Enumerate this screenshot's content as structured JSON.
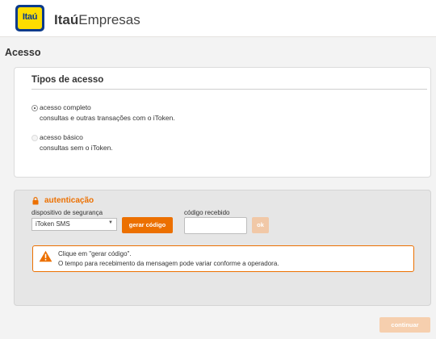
{
  "header": {
    "logo_text": "Itaú",
    "brand_bold": "Itaú",
    "brand_rest": "Empresas"
  },
  "page": {
    "title": "Acesso"
  },
  "access_types": {
    "title": "Tipos de acesso",
    "options": [
      {
        "label": "acesso completo",
        "description": "consultas e outras transações com o iToken.",
        "selected": true,
        "enabled": true
      },
      {
        "label": "acesso básico",
        "description": "consultas sem o iToken.",
        "selected": false,
        "enabled": false
      }
    ]
  },
  "authentication": {
    "title": "autenticação",
    "device_label": "dispositivo de segurança",
    "device_value": "iToken SMS",
    "generate_button": "gerar código",
    "code_label": "código recebido",
    "code_value": "",
    "ok_button": "ok",
    "alert": {
      "line1": "Clique em \"gerar código\".",
      "line2": "O tempo para recebimento da mensagem pode variar conforme a operadora."
    }
  },
  "footer": {
    "continue_button": "continuar"
  },
  "colors": {
    "brand_orange": "#ec7000",
    "brand_blue": "#0b3b8c",
    "brand_yellow": "#fedd00"
  }
}
